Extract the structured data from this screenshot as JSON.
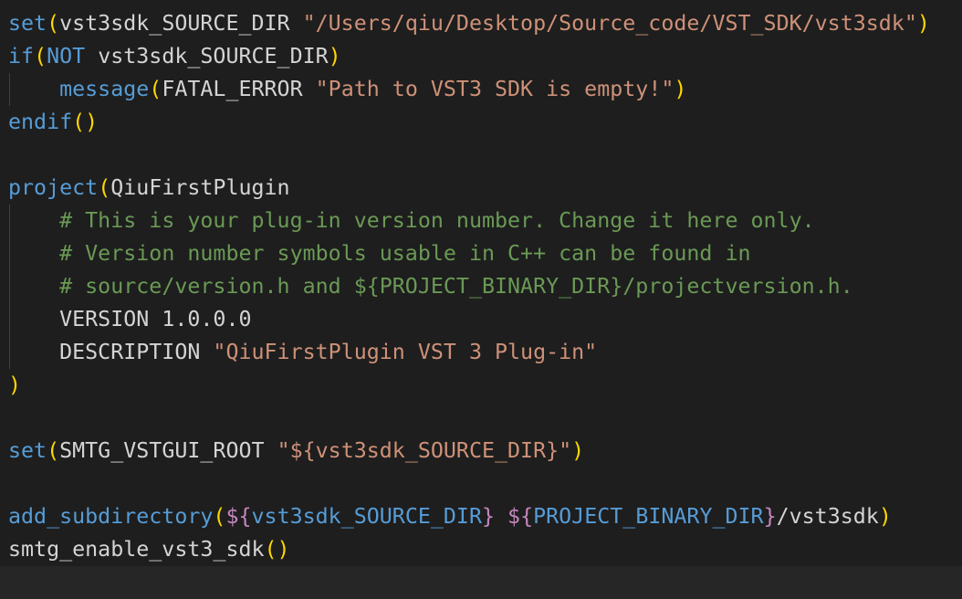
{
  "editor": {
    "colors": {
      "background": "#1e1e1e",
      "keyword": "#569cd6",
      "bracket": "#ffd700",
      "string": "#ce9178",
      "comment": "#6a9955",
      "variable_delimiter": "#c586c0",
      "text": "#d4d4d4"
    },
    "lines": [
      {
        "tokens": [
          {
            "t": "set",
            "c": "fn"
          },
          {
            "t": "(",
            "c": "p"
          },
          {
            "t": "vst3sdk_SOURCE_DIR ",
            "c": "tx"
          },
          {
            "t": "\"/Users/qiu/Desktop/Source_code/VST_SDK/vst3sdk\"",
            "c": "str"
          },
          {
            "t": ")",
            "c": "p"
          }
        ]
      },
      {
        "tokens": [
          {
            "t": "if",
            "c": "kw"
          },
          {
            "t": "(",
            "c": "p"
          },
          {
            "t": "NOT",
            "c": "kw"
          },
          {
            "t": " vst3sdk_SOURCE_DIR",
            "c": "tx"
          },
          {
            "t": ")",
            "c": "p"
          }
        ]
      },
      {
        "guide": true,
        "tokens": [
          {
            "t": "    ",
            "c": "tx"
          },
          {
            "t": "message",
            "c": "fn"
          },
          {
            "t": "(",
            "c": "p"
          },
          {
            "t": "FATAL_ERROR ",
            "c": "tx"
          },
          {
            "t": "\"Path to VST3 SDK is empty!\"",
            "c": "str"
          },
          {
            "t": ")",
            "c": "p"
          }
        ]
      },
      {
        "tokens": [
          {
            "t": "endif",
            "c": "kw"
          },
          {
            "t": "()",
            "c": "p"
          }
        ]
      },
      {
        "tokens": []
      },
      {
        "tokens": [
          {
            "t": "project",
            "c": "fn"
          },
          {
            "t": "(",
            "c": "p"
          },
          {
            "t": "QiuFirstPlugin",
            "c": "tx"
          }
        ]
      },
      {
        "guide": true,
        "tokens": [
          {
            "t": "    ",
            "c": "tx"
          },
          {
            "t": "# This is your plug-in version number. Change it here only.",
            "c": "cm"
          }
        ]
      },
      {
        "guide": true,
        "tokens": [
          {
            "t": "    ",
            "c": "tx"
          },
          {
            "t": "# Version number symbols usable in C++ can be found in",
            "c": "cm"
          }
        ]
      },
      {
        "guide": true,
        "tokens": [
          {
            "t": "    ",
            "c": "tx"
          },
          {
            "t": "# source/version.h and ${PROJECT_BINARY_DIR}/projectversion.h.",
            "c": "cm"
          }
        ]
      },
      {
        "guide": true,
        "tokens": [
          {
            "t": "    VERSION 1.0.0.0",
            "c": "tx"
          }
        ]
      },
      {
        "guide": true,
        "tokens": [
          {
            "t": "    DESCRIPTION ",
            "c": "tx"
          },
          {
            "t": "\"QiuFirstPlugin VST 3 Plug-in\"",
            "c": "str"
          }
        ]
      },
      {
        "tokens": [
          {
            "t": ")",
            "c": "p"
          }
        ]
      },
      {
        "tokens": []
      },
      {
        "tokens": [
          {
            "t": "set",
            "c": "fn"
          },
          {
            "t": "(",
            "c": "p"
          },
          {
            "t": "SMTG_VSTGUI_ROOT ",
            "c": "tx"
          },
          {
            "t": "\"${vst3sdk_SOURCE_DIR}\"",
            "c": "str"
          },
          {
            "t": ")",
            "c": "p"
          }
        ]
      },
      {
        "tokens": []
      },
      {
        "tokens": [
          {
            "t": "add_subdirectory",
            "c": "fn"
          },
          {
            "t": "(",
            "c": "p"
          },
          {
            "t": "${",
            "c": "dl"
          },
          {
            "t": "vst3sdk_SOURCE_DIR",
            "c": "var"
          },
          {
            "t": "}",
            "c": "dl"
          },
          {
            "t": " ",
            "c": "tx"
          },
          {
            "t": "${",
            "c": "dl"
          },
          {
            "t": "PROJECT_BINARY_DIR",
            "c": "var"
          },
          {
            "t": "}",
            "c": "dl"
          },
          {
            "t": "/vst3sdk",
            "c": "tx"
          },
          {
            "t": ")",
            "c": "p"
          }
        ]
      },
      {
        "tokens": [
          {
            "t": "smtg_enable_vst3_sdk",
            "c": "tx"
          },
          {
            "t": "()",
            "c": "p"
          }
        ]
      },
      {
        "current": true,
        "tokens": []
      }
    ]
  }
}
